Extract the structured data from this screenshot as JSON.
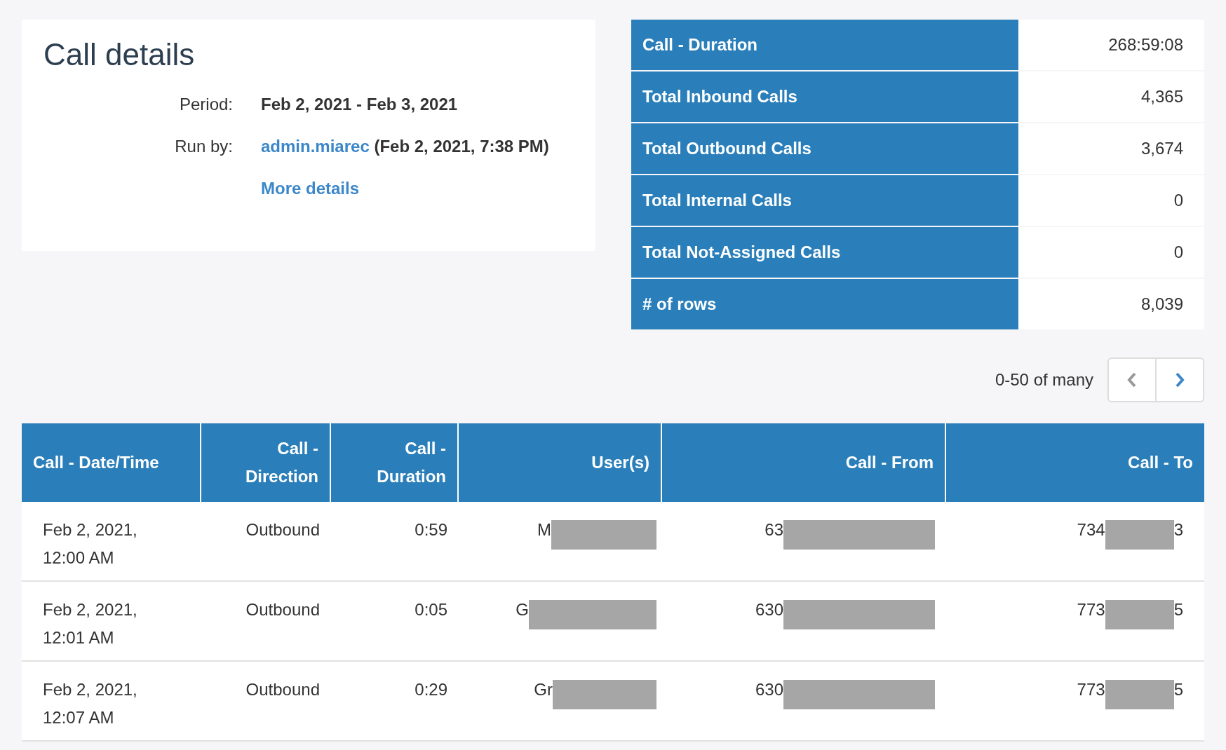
{
  "details": {
    "title": "Call details",
    "fields": [
      {
        "label": "Period:",
        "value": "Feb 2, 2021 - Feb 3, 2021"
      },
      {
        "label": "Run by:",
        "link": "admin.miarec",
        "value": "(Feb 2, 2021, 7:38 PM)"
      }
    ],
    "more_link": "More details"
  },
  "summary": [
    {
      "label": "Call - Duration",
      "value": "268:59:08"
    },
    {
      "label": "Total Inbound Calls",
      "value": "4,365"
    },
    {
      "label": "Total Outbound Calls",
      "value": "3,674"
    },
    {
      "label": "Total Internal Calls",
      "value": "0"
    },
    {
      "label": "Total Not-Assigned Calls",
      "value": "0"
    },
    {
      "label": "# of rows",
      "value": "8,039"
    }
  ],
  "pagination": {
    "range": "0-50 of many",
    "prev_disabled": true,
    "next_disabled": false
  },
  "table": {
    "columns": [
      "Call - Date/Time",
      "Call - Direction",
      "Call - Duration",
      "User(s)",
      "Call - From",
      "Call - To"
    ],
    "rows": [
      {
        "datetime": "Feb 2, 2021, 12:00 AM",
        "direction": "Outbound",
        "duration": "0:59",
        "user": {
          "visible": "M"
        },
        "from": {
          "visible": "63"
        },
        "to": {
          "visible": "734",
          "tail": "3"
        }
      },
      {
        "datetime": "Feb 2, 2021, 12:01 AM",
        "direction": "Outbound",
        "duration": "0:05",
        "user": {
          "visible": "G"
        },
        "from": {
          "visible": "630"
        },
        "to": {
          "visible": "773",
          "tail": "5"
        }
      },
      {
        "datetime": "Feb 2, 2021, 12:07 AM",
        "direction": "Outbound",
        "duration": "0:29",
        "user": {
          "visible": "Gr"
        },
        "from": {
          "visible": "630"
        },
        "to": {
          "visible": "773",
          "tail": "5"
        }
      }
    ]
  }
}
